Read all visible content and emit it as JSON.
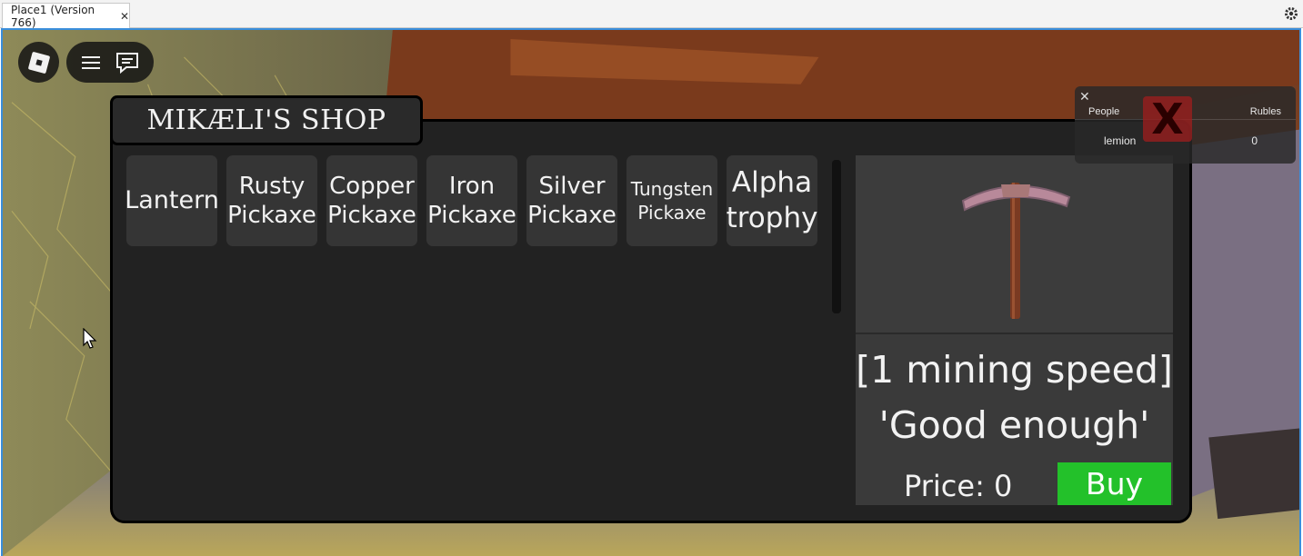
{
  "window": {
    "tab_label": "Place1 (Version 766)",
    "tab_close": "✕"
  },
  "shop": {
    "title": "MIKÆLI'S SHOP",
    "items": [
      {
        "label": "Lantern"
      },
      {
        "label": "Rusty Pickaxe"
      },
      {
        "label": "Copper Pickaxe"
      },
      {
        "label": "Iron Pickaxe"
      },
      {
        "label": "Silver Pickaxe"
      },
      {
        "label": "Tungsten Pickaxe"
      },
      {
        "label": "Alpha trophy"
      }
    ],
    "preview": {
      "image_icon": "pickaxe-icon",
      "description": "[1 mining speed] 'Good enough'",
      "price_text": "Price: 0",
      "buy_label": "Buy"
    }
  },
  "leaderboard": {
    "close": "✕",
    "col_people": "People",
    "col_rubles": "Rubles",
    "rows": [
      {
        "name": "lemion",
        "rubles": "0"
      }
    ],
    "overlay_mark": "X"
  },
  "colors": {
    "viewport_border": "#3a8edb",
    "shop_bg": "#222222",
    "item_bg": "#353535",
    "buy_green": "#23c12a"
  }
}
